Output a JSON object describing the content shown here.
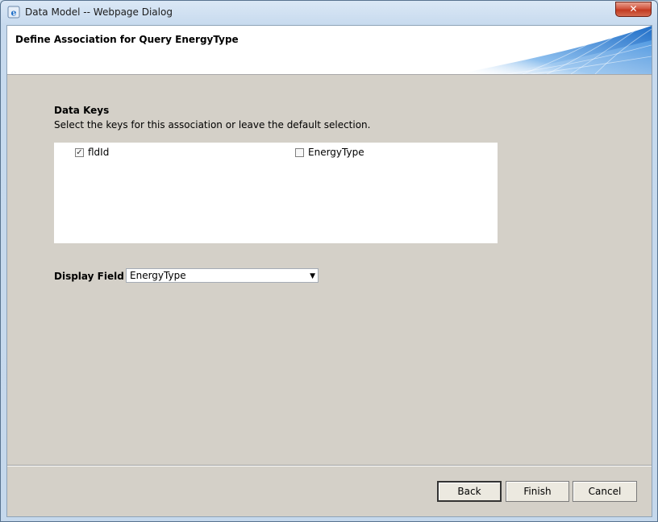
{
  "window": {
    "title": "Data Model -- Webpage Dialog",
    "close_label": "✕"
  },
  "header": {
    "title": "Define Association for Query EnergyType"
  },
  "data_keys": {
    "title": "Data Keys",
    "description": "Select the keys for this association or leave the default selection.",
    "items": [
      {
        "label": "fldId",
        "checked": true
      },
      {
        "label": "EnergyType",
        "checked": false
      }
    ]
  },
  "display_field": {
    "label": "Display Field",
    "selected": "EnergyType"
  },
  "buttons": {
    "back": "Back",
    "finish": "Finish",
    "cancel": "Cancel"
  },
  "icons": {
    "app": "ie-icon",
    "close": "close-icon",
    "dropdown": "chevron-down-icon"
  },
  "colors": {
    "dialog_bg": "#d4d0c8",
    "close_button": "#c23a20",
    "header_swoosh": "#2f7fd2"
  }
}
